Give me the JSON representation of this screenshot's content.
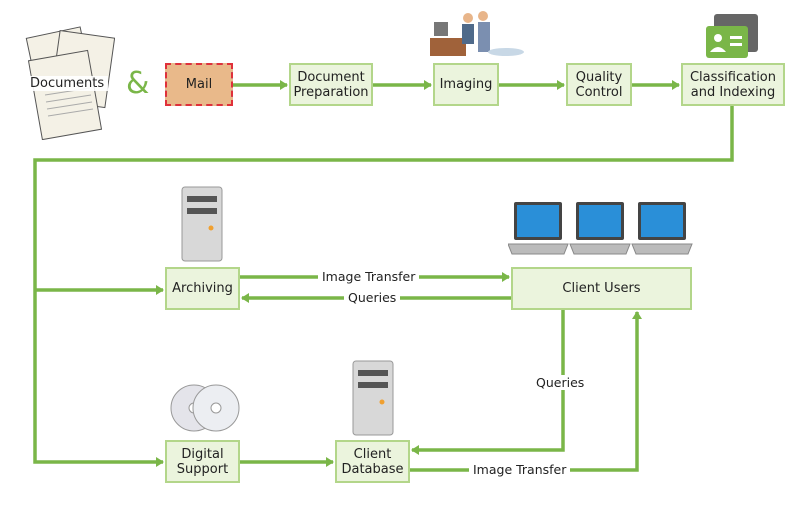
{
  "colors": {
    "flow": "#7ab648",
    "box_fill": "#ebf4dd",
    "box_border": "#b3d68a",
    "mail_fill": "#e9b98a"
  },
  "top": {
    "documents": "Documents",
    "ampersand": "&",
    "mail": "Mail",
    "doc_prep_1": "Document",
    "doc_prep_2": "Preparation",
    "imaging": "Imaging",
    "qc_1": "Quality",
    "qc_2": "Control",
    "class_1": "Classification",
    "class_2": "and Indexing"
  },
  "bottom": {
    "archiving": "Archiving",
    "client_users": "Client Users",
    "image_transfer_1": "Image Transfer",
    "queries_1": "Queries",
    "digital_1": "Digital",
    "digital_2": "Support",
    "db_1": "Client",
    "db_2": "Database",
    "queries_2": "Queries",
    "image_transfer_2": "Image Transfer"
  },
  "icons": [
    "documents-icon",
    "people-at-computer-icon",
    "id-card-folder-icon",
    "server-icon",
    "laptop-icon",
    "cd-disc-icon"
  ]
}
